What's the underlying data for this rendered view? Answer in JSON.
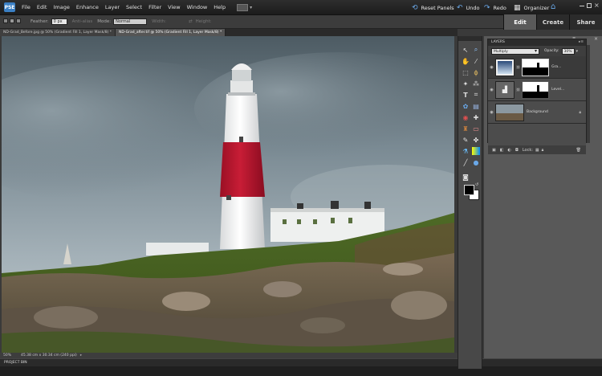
{
  "app": {
    "logo": "PSE"
  },
  "menu": [
    "File",
    "Edit",
    "Image",
    "Enhance",
    "Layer",
    "Select",
    "Filter",
    "View",
    "Window",
    "Help"
  ],
  "top_actions": {
    "reset": "Reset Panels",
    "undo": "Undo",
    "redo": "Redo",
    "organizer": "Organizer"
  },
  "options": {
    "feather_label": "Feather:",
    "feather_value": "0 px",
    "antialias": "Anti-alias",
    "mode_label": "Mode:",
    "mode_value": "Normal",
    "width_label": "Width:",
    "height_label": "Height:"
  },
  "modes": {
    "edit": "Edit",
    "create": "Create",
    "share": "Share"
  },
  "doc_tabs": [
    {
      "label": "ND-Grad_Before.jpg @ 50% (Gradient Fill 1, Layer Mask/8) *"
    },
    {
      "label": "ND-Grad_after.tif @ 50% (Gradient Fill 1, Layer Mask/8) *"
    }
  ],
  "status": {
    "zoom": "50%",
    "doc_size": "45.38 cm x 30.34 cm (240 ppi)"
  },
  "project_bin": "PROJECT BIN",
  "layers": {
    "title": "LAYERS",
    "blend_mode": "Multiply",
    "opacity_label": "Opacity:",
    "opacity_value": "30%",
    "lock_label": "Lock:",
    "items": [
      {
        "name": "Gra..."
      },
      {
        "name": "Level..."
      },
      {
        "name": "Background"
      }
    ]
  },
  "colors": {
    "accent": "#3a7fc4",
    "stripe": "#b5162e",
    "sky": "#7c8a92"
  }
}
